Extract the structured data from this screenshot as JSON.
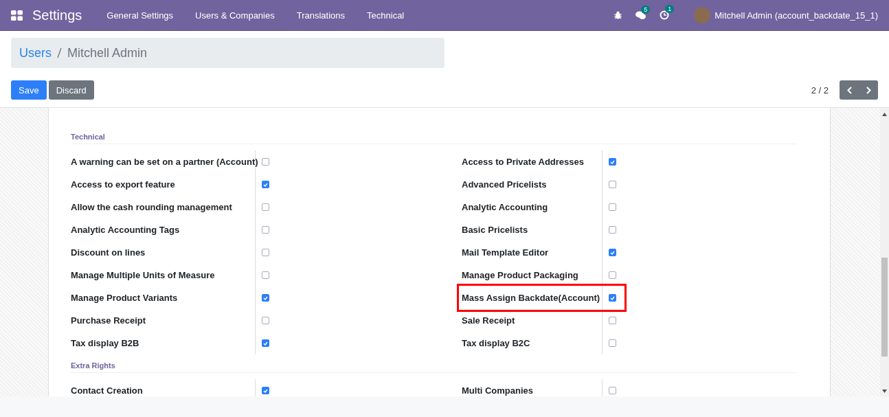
{
  "navbar": {
    "app_title": "Settings",
    "menu": [
      "General Settings",
      "Users & Companies",
      "Translations",
      "Technical"
    ],
    "messages_badge": "5",
    "activities_badge": "1",
    "user": "Mitchell Admin (account_backdate_15_1)"
  },
  "breadcrumb": {
    "parent": "Users",
    "current": "Mitchell Admin"
  },
  "buttons": {
    "save": "Save",
    "discard": "Discard"
  },
  "pager": {
    "value": "2 / 2"
  },
  "groups": [
    {
      "title": "Technical",
      "rows": [
        {
          "left": {
            "label": "A warning can be set on a partner (Account)",
            "checked": false,
            "highlighted": false
          },
          "right": {
            "label": "Access to Private Addresses",
            "checked": true,
            "highlighted": false
          }
        },
        {
          "left": {
            "label": "Access to export feature",
            "checked": true,
            "highlighted": false
          },
          "right": {
            "label": "Advanced Pricelists",
            "checked": false,
            "highlighted": false
          }
        },
        {
          "left": {
            "label": "Allow the cash rounding management",
            "checked": false,
            "highlighted": false
          },
          "right": {
            "label": "Analytic Accounting",
            "checked": false,
            "highlighted": false
          }
        },
        {
          "left": {
            "label": "Analytic Accounting Tags",
            "checked": false,
            "highlighted": false
          },
          "right": {
            "label": "Basic Pricelists",
            "checked": false,
            "highlighted": false
          }
        },
        {
          "left": {
            "label": "Discount on lines",
            "checked": false,
            "highlighted": false
          },
          "right": {
            "label": "Mail Template Editor",
            "checked": true,
            "highlighted": false
          }
        },
        {
          "left": {
            "label": "Manage Multiple Units of Measure",
            "checked": false,
            "highlighted": false
          },
          "right": {
            "label": "Manage Product Packaging",
            "checked": false,
            "highlighted": false
          }
        },
        {
          "left": {
            "label": "Manage Product Variants",
            "checked": true,
            "highlighted": false
          },
          "right": {
            "label": "Mass Assign Backdate(Account)",
            "checked": true,
            "highlighted": true
          }
        },
        {
          "left": {
            "label": "Purchase Receipt",
            "checked": false,
            "highlighted": false
          },
          "right": {
            "label": "Sale Receipt",
            "checked": false,
            "highlighted": false
          }
        },
        {
          "left": {
            "label": "Tax display B2B",
            "checked": true,
            "highlighted": false
          },
          "right": {
            "label": "Tax display B2C",
            "checked": false,
            "highlighted": false
          }
        }
      ]
    },
    {
      "title": "Extra Rights",
      "rows": [
        {
          "left": {
            "label": "Contact Creation",
            "checked": true,
            "highlighted": false
          },
          "right": {
            "label": "Multi Companies",
            "checked": false,
            "highlighted": false
          }
        }
      ]
    }
  ]
}
